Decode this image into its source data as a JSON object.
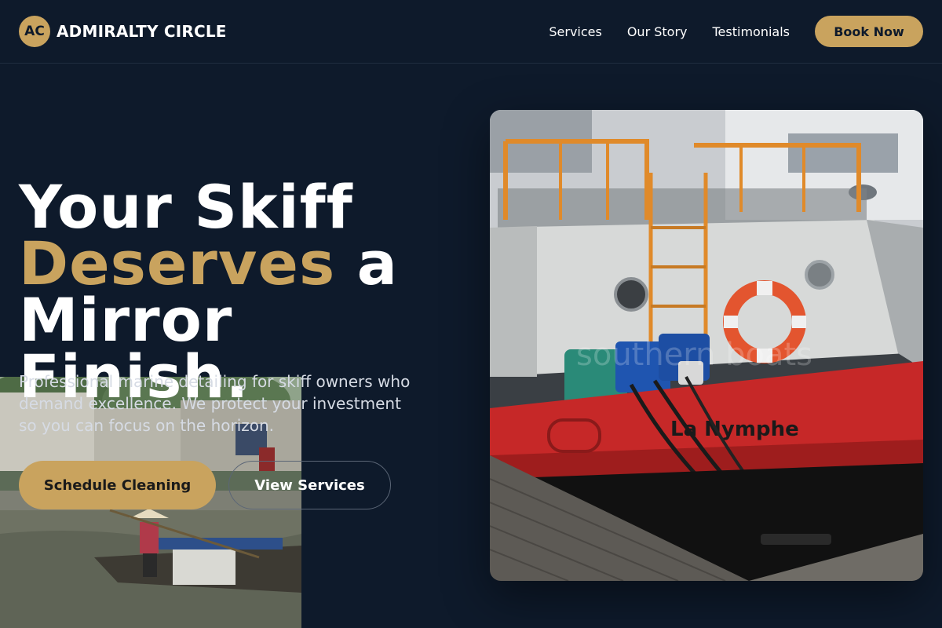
{
  "brand": {
    "initials": "AC",
    "name": "ADMIRALTY CIRCLE"
  },
  "nav": {
    "links": [
      "Services",
      "Our Story",
      "Testimonials"
    ],
    "cta": "Book Now"
  },
  "hero": {
    "title_line1": "Your Skiff",
    "title_accent": "Deserves",
    "title_after_accent": " a",
    "title_line3": "Mirror Finish.",
    "subtitle": "Professional marine detailing for skiff owners who demand excellence. We protect your investment so you can focus on the horizon.",
    "primary_button": "Schedule Cleaning",
    "secondary_button": "View Services"
  },
  "images": {
    "hero_watermark": "southern boats",
    "hero_boat_name": "La Nymphe"
  },
  "colors": {
    "background": "#0e1a2b",
    "accent": "#c9a35e",
    "text": "#ffffff",
    "muted_text": "#d6dbe4",
    "boat_hull": "#c62828"
  }
}
